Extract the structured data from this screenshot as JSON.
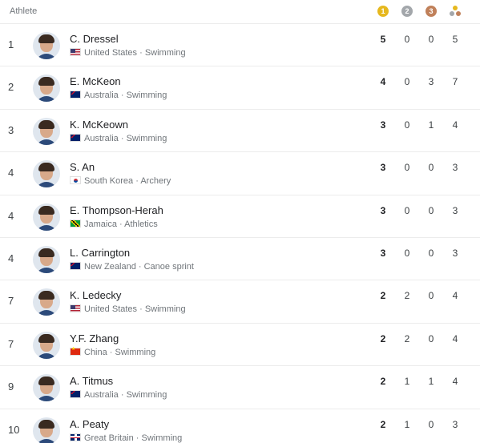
{
  "header": {
    "athlete_label": "Athlete",
    "medals": {
      "gold_glyph": "1",
      "silver_glyph": "2",
      "bronze_glyph": "3",
      "gold_color": "#e6b81e",
      "silver_color": "#a3a7ab",
      "bronze_color": "#c0805a"
    }
  },
  "athletes": [
    {
      "rank": "1",
      "name": "C. Dressel",
      "country": "United States",
      "sport": "Swimming",
      "flag": "us",
      "gold": "5",
      "silver": "0",
      "bronze": "0",
      "total": "5"
    },
    {
      "rank": "2",
      "name": "E. McKeon",
      "country": "Australia",
      "sport": "Swimming",
      "flag": "au",
      "gold": "4",
      "silver": "0",
      "bronze": "3",
      "total": "7"
    },
    {
      "rank": "3",
      "name": "K. McKeown",
      "country": "Australia",
      "sport": "Swimming",
      "flag": "au",
      "gold": "3",
      "silver": "0",
      "bronze": "1",
      "total": "4"
    },
    {
      "rank": "4",
      "name": "S. An",
      "country": "South Korea",
      "sport": "Archery",
      "flag": "kr",
      "gold": "3",
      "silver": "0",
      "bronze": "0",
      "total": "3"
    },
    {
      "rank": "4",
      "name": "E. Thompson-Herah",
      "country": "Jamaica",
      "sport": "Athletics",
      "flag": "jm",
      "gold": "3",
      "silver": "0",
      "bronze": "0",
      "total": "3"
    },
    {
      "rank": "4",
      "name": "L. Carrington",
      "country": "New Zealand",
      "sport": "Canoe sprint",
      "flag": "nz",
      "gold": "3",
      "silver": "0",
      "bronze": "0",
      "total": "3"
    },
    {
      "rank": "7",
      "name": "K. Ledecky",
      "country": "United States",
      "sport": "Swimming",
      "flag": "us",
      "gold": "2",
      "silver": "2",
      "bronze": "0",
      "total": "4"
    },
    {
      "rank": "7",
      "name": "Y.F. Zhang",
      "country": "China",
      "sport": "Swimming",
      "flag": "cn",
      "gold": "2",
      "silver": "2",
      "bronze": "0",
      "total": "4"
    },
    {
      "rank": "9",
      "name": "A. Titmus",
      "country": "Australia",
      "sport": "Swimming",
      "flag": "au",
      "gold": "2",
      "silver": "1",
      "bronze": "1",
      "total": "4"
    },
    {
      "rank": "10",
      "name": "A. Peaty",
      "country": "Great Britain",
      "sport": "Swimming",
      "flag": "gb",
      "gold": "2",
      "silver": "1",
      "bronze": "0",
      "total": "3"
    }
  ],
  "separator": " · "
}
